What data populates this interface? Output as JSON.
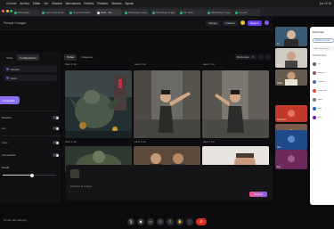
{
  "menubar": {
    "items": [
      "Chrome",
      "Archivo",
      "Editar",
      "Ver",
      "Historial",
      "Marcadores",
      "Perfiles",
      "Pestaña",
      "Ventana",
      "Ayuda"
    ],
    "clock": "jue 12:46"
  },
  "tabs": [
    {
      "label": "WhatsApp"
    },
    {
      "label": "Cam & Accounts"
    },
    {
      "label": "Nueva Pestaña"
    },
    {
      "label": "Meet - Ro..."
    },
    {
      "label": "WhatsApp Image"
    },
    {
      "label": "WhatsApp Image"
    },
    {
      "label": "Sin título"
    },
    {
      "label": "WhatsApp Image"
    },
    {
      "label": "Freepik"
    }
  ],
  "app": {
    "breadcrumb": "Freepik / Imagen",
    "header_right": [
      "Planes",
      "Créditos"
    ],
    "upgrade": "Mejorar"
  },
  "left_panel": {
    "tabs": [
      "Tabla",
      "Configuración"
    ],
    "fields": [
      "Modelo",
      "Estilo"
    ],
    "pill": "Fotográfico",
    "rows": [
      "Relación",
      "Luz",
      "Color",
      "Composición",
      "Detalle"
    ],
    "slider_value": 0.55
  },
  "center": {
    "tabs": [
      "Todas",
      "Imágenes"
    ],
    "select_label": "Recientes",
    "meta_labels": [
      "Hace 2 min",
      "Hace 3 min",
      "Hace 5 min"
    ],
    "prompt_placeholder": "Describe tu imagen...",
    "generate": "Generar"
  },
  "participants": [
    {
      "name": "Tú"
    },
    {
      "name": "Sofía"
    },
    {
      "name": "Pablo"
    },
    {
      "name": "Tomás Gil"
    },
    {
      "name": "Irene"
    },
    {
      "name": "Nico"
    },
    {
      "name": "Eva"
    }
  ],
  "meet_panel": {
    "title": "Personas",
    "add": "Añadir personas",
    "search": "Buscar personas",
    "section": "Contribuciones",
    "people": [
      {
        "name": "Tú",
        "color": "#5f6368"
      },
      {
        "name": "Sofía M.",
        "color": "#7b5e57"
      },
      {
        "name": "Pablo R.",
        "color": "#4e6a8a"
      },
      {
        "name": "Tomás Gil",
        "color": "#d64a3a"
      },
      {
        "name": "Irene",
        "color": "#8d6e63"
      },
      {
        "name": "Nico",
        "color": "#1565c0"
      },
      {
        "name": "Eva",
        "color": "#6a1b9a"
      }
    ]
  },
  "meet": {
    "meeting_code": "12:46 | abc-defg-hij"
  }
}
